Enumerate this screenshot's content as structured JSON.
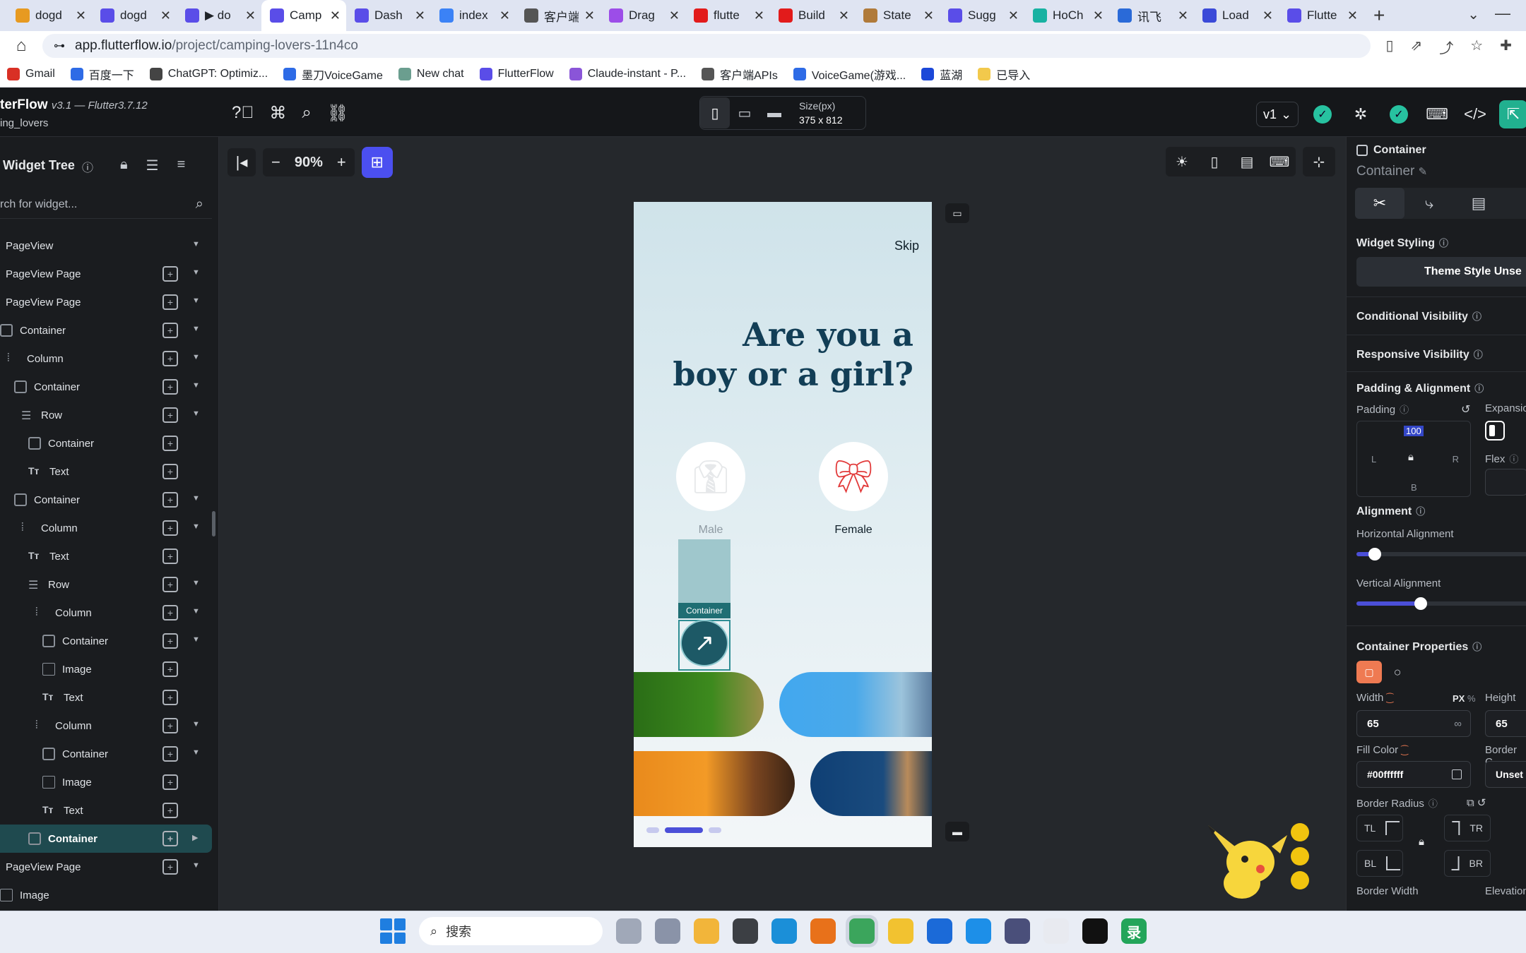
{
  "browser": {
    "tabs": [
      {
        "title": "dogd",
        "icon_color": "#e79a21",
        "active": false
      },
      {
        "title": "dogd",
        "icon_color": "#5a4de8",
        "active": false
      },
      {
        "title": "▶ do",
        "icon_color": "#5a4de8",
        "active": false
      },
      {
        "title": "Camp",
        "icon_color": "#5a4de8",
        "active": true
      },
      {
        "title": "Dash",
        "icon_color": "#5a4de8",
        "active": false
      },
      {
        "title": "index",
        "icon_color": "#3b82f6",
        "active": false
      },
      {
        "title": "客户端",
        "icon_color": "#555555",
        "active": false
      },
      {
        "title": "Drag",
        "icon_color": "#9c4de8",
        "active": false
      },
      {
        "title": "flutte",
        "icon_color": "#e21b1b",
        "active": false
      },
      {
        "title": "Build",
        "icon_color": "#e21b1b",
        "active": false
      },
      {
        "title": "State",
        "icon_color": "#b07a3a",
        "active": false
      },
      {
        "title": "Sugg",
        "icon_color": "#5a4de8",
        "active": false
      },
      {
        "title": "HoCh",
        "icon_color": "#18b2a2",
        "active": false
      },
      {
        "title": "讯飞",
        "icon_color": "#2a6ad8",
        "active": false
      },
      {
        "title": "Load",
        "icon_color": "#3b4ad8",
        "active": false
      },
      {
        "title": "Flutte",
        "icon_color": "#5a4de8",
        "active": false
      }
    ],
    "url_host": "app.flutterflow.io",
    "url_path": "/project/camping-lovers-11n4co",
    "bookmarks": [
      {
        "label": "Gmail",
        "color": "#d93025"
      },
      {
        "label": "百度一下",
        "color": "#2e6be6"
      },
      {
        "label": "ChatGPT: Optimiz...",
        "color": "#444444"
      },
      {
        "label": "墨刀VoiceGame",
        "color": "#2e6be6"
      },
      {
        "label": "New chat",
        "color": "#6b9e8f"
      },
      {
        "label": "FlutterFlow",
        "color": "#5a4de8"
      },
      {
        "label": "Claude-instant - P...",
        "color": "#8a55d8"
      },
      {
        "label": "客户端APIs",
        "color": "#555555"
      },
      {
        "label": "VoiceGame(游戏...",
        "color": "#2e6be6"
      },
      {
        "label": "蓝湖",
        "color": "#1c48d8"
      },
      {
        "label": "已导入",
        "color": "#f2c94c"
      }
    ]
  },
  "app": {
    "brand": "terFlow",
    "version": "v3.1 — Flutter3.7.12",
    "project": "ing_lovers",
    "device_size_label": "Size(px)",
    "device_size": "375 x 812",
    "version_select": "v1",
    "accent": "#4b4ff0"
  },
  "widget_tree": {
    "title": "Widget Tree",
    "search_placeholder": "rch for widget...",
    "nodes": [
      {
        "label": "PageView",
        "type": "plain"
      },
      {
        "label": "PageView Page",
        "type": "plain"
      },
      {
        "label": "PageView Page",
        "type": "plain"
      },
      {
        "label": "Container",
        "type": "box"
      },
      {
        "label": "Column",
        "type": "column"
      },
      {
        "label": "Container",
        "type": "box"
      },
      {
        "label": "Row",
        "type": "row"
      },
      {
        "label": "Container",
        "type": "box"
      },
      {
        "label": "Text",
        "type": "text"
      },
      {
        "label": "Container",
        "type": "box"
      },
      {
        "label": "Column",
        "type": "column"
      },
      {
        "label": "Text",
        "type": "text"
      },
      {
        "label": "Row",
        "type": "row"
      },
      {
        "label": "Column",
        "type": "column"
      },
      {
        "label": "Container",
        "type": "box"
      },
      {
        "label": "Image",
        "type": "image"
      },
      {
        "label": "Text",
        "type": "text"
      },
      {
        "label": "Column",
        "type": "column"
      },
      {
        "label": "Container",
        "type": "box"
      },
      {
        "label": "Image",
        "type": "image"
      },
      {
        "label": "Text",
        "type": "text"
      },
      {
        "label": "Container",
        "type": "box",
        "selected": true
      },
      {
        "label": "PageView Page",
        "type": "plain"
      },
      {
        "label": "Image",
        "type": "image"
      }
    ]
  },
  "canvas": {
    "zoom": "90%",
    "screen": {
      "skip": "Skip",
      "question_line1": "Are you a",
      "question_line2": "boy or a girl?",
      "male_label": "Male",
      "female_label": "Female",
      "selected_widget_tag": "Container"
    }
  },
  "properties": {
    "widget_type": "Container",
    "widget_name": "Container",
    "widget_styling": "Widget Styling",
    "theme_style": "Theme Style Unse",
    "conditional_visibility": "Conditional Visibility",
    "responsive_visibility": "Responsive Visibility",
    "padding_alignment": "Padding & Alignment",
    "padding_label": "Padding",
    "padding_top": "100",
    "padding_l": "L",
    "padding_r": "R",
    "padding_b": "B",
    "expansion": "Expansio",
    "flex": "Flex",
    "alignment": "Alignment",
    "horizontal_alignment": "Horizontal Alignment",
    "horizontal_value": 0.1,
    "vertical_alignment": "Vertical Alignment",
    "vertical_value": 0.35,
    "container_properties": "Container Properties",
    "width_label": "Width",
    "width_unit_px": "PX",
    "width_unit_pct": "%",
    "width_value": "65",
    "width_suffix": "∞",
    "height_label": "Height",
    "height_value": "65",
    "fill_color_label": "Fill Color",
    "fill_color_value": "#00ffffff",
    "border_color_label": "Border C",
    "border_color_value": "Unset",
    "border_radius_label": "Border Radius",
    "tl": "TL",
    "tr": "TR",
    "bl": "BL",
    "br": "BR",
    "border_width_label": "Border Width",
    "elevation_label": "Elevation"
  },
  "taskbar": {
    "search_label": "搜索",
    "apps": [
      {
        "name": "file-explorer",
        "color": "#a0a8b8"
      },
      {
        "name": "discord",
        "color": "#8a93a8"
      },
      {
        "name": "folder",
        "color": "#f2b53a"
      },
      {
        "name": "unity",
        "color": "#3c3f44"
      },
      {
        "name": "edge",
        "color": "#1b8fd8"
      },
      {
        "name": "firefox",
        "color": "#e8711a"
      },
      {
        "name": "chrome",
        "color": "#3ba55c"
      },
      {
        "name": "star",
        "color": "#f2c230"
      },
      {
        "name": "quick",
        "color": "#1b6ad8"
      },
      {
        "name": "feishu",
        "color": "#1d8fe8"
      },
      {
        "name": "cat",
        "color": "#4a4f7a"
      },
      {
        "name": "pinwheel",
        "color": "#e8eaf0"
      },
      {
        "name": "capcut",
        "color": "#111111"
      },
      {
        "name": "recorder",
        "color": "#23a55a"
      }
    ],
    "recorder_label": "录"
  }
}
